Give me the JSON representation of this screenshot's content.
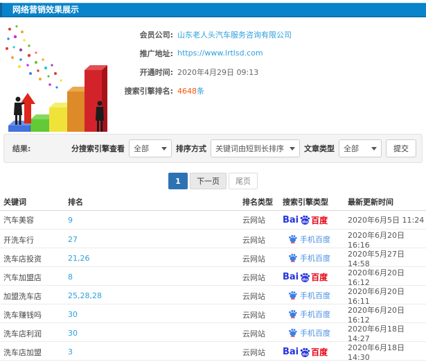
{
  "header": {
    "title": "网络营销效果展示"
  },
  "info": {
    "fields": [
      {
        "label": "会员公司:",
        "value": "山东老人头汽车服务咨询有限公司"
      },
      {
        "label": "推广地址:",
        "value": "https://www.lrtlsd.com"
      },
      {
        "label": "开通时间:",
        "value": "2020年4月29日 09:13"
      },
      {
        "label": "搜索引擎排名:",
        "value": "4648",
        "suffix": "条"
      }
    ]
  },
  "filters": {
    "result_label": "结果:",
    "engine_label": "分搜索引擎查看",
    "engine_value": "全部",
    "sort_label": "排序方式",
    "sort_value": "关键词由短到长排序",
    "article_label": "文章类型",
    "article_value": "全部",
    "submit_label": "提交"
  },
  "pagination": {
    "current": "1",
    "next": "下一页",
    "last": "尾页"
  },
  "icons": {
    "baidu_pc": {
      "bai": "Bai",
      "du": "du",
      "cn": "百度"
    },
    "baidu_mobile": {
      "label": "手机百度"
    }
  },
  "colors": {
    "header_bar": "#0983ca",
    "link_blue": "#2d9fdc",
    "highlight_red": "#ff5500",
    "baidu_blue": "#2534de",
    "baidu_red": "#e60012",
    "mobile_blue": "#4a90e2",
    "pagination_active": "#2d73b4"
  },
  "table": {
    "headers": [
      "关键词",
      "排名",
      "排名类型",
      "搜索引擎类型",
      "最新更新时间"
    ],
    "rows": [
      {
        "keyword": "汽车美容",
        "rank": "9",
        "rank_type": "云网站",
        "engine": "baidu_pc",
        "time": "2020年6月5日 11:24"
      },
      {
        "keyword": "开洗车行",
        "rank": "27",
        "rank_type": "云网站",
        "engine": "baidu_mobile",
        "time": "2020年6月20日 16:16"
      },
      {
        "keyword": "洗车店投资",
        "rank": "21,26",
        "rank_type": "云网站",
        "engine": "baidu_mobile",
        "time": "2020年5月27日 14:58"
      },
      {
        "keyword": "汽车加盟店",
        "rank": "8",
        "rank_type": "云网站",
        "engine": "baidu_pc",
        "time": "2020年6月20日 16:12"
      },
      {
        "keyword": "加盟洗车店",
        "rank": "25,28,28",
        "rank_type": "云网站",
        "engine": "baidu_mobile",
        "time": "2020年6月20日 16:11"
      },
      {
        "keyword": "洗车赚钱吗",
        "rank": "30",
        "rank_type": "云网站",
        "engine": "baidu_mobile",
        "time": "2020年6月20日 16:12"
      },
      {
        "keyword": "洗车店利润",
        "rank": "30",
        "rank_type": "云网站",
        "engine": "baidu_mobile",
        "time": "2020年6月18日 14:27"
      },
      {
        "keyword": "洗车店加盟",
        "rank": "3",
        "rank_type": "云网站",
        "engine": "baidu_pc",
        "time": "2020年6月18日 14:30"
      }
    ]
  }
}
